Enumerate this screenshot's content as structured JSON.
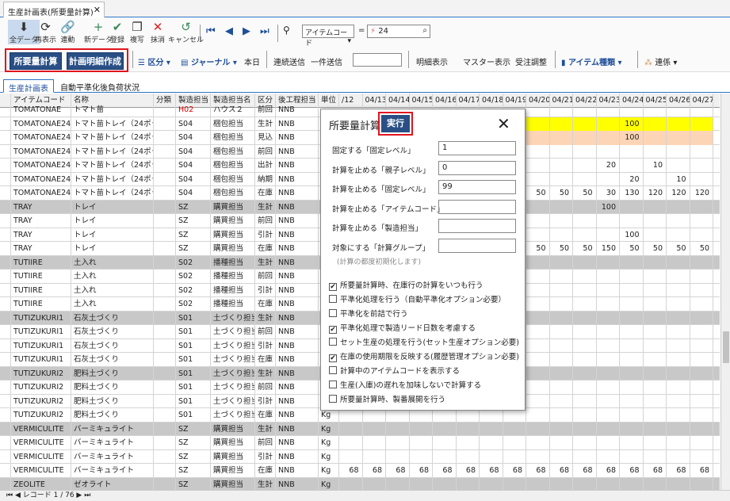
{
  "tab_title": "生産計画表(所要量計算)",
  "toolbar1": [
    {
      "label": "全データ",
      "icon": "⬇"
    },
    {
      "label": "再表示",
      "icon": "⟳"
    },
    {
      "label": "連動",
      "icon": "🔗"
    },
    {
      "label": "新データ",
      "icon": "+"
    },
    {
      "label": "登録",
      "icon": "✔"
    },
    {
      "label": "複写",
      "icon": "❐"
    },
    {
      "label": "抹消",
      "icon": "✕"
    },
    {
      "label": "キャンセル",
      "icon": "↺"
    }
  ],
  "filter": {
    "field": "アイテムコード",
    "op": "=",
    "value": "24"
  },
  "toolbar2": {
    "shoyo": "所要量計算",
    "keikaku": "計画明細作成",
    "kubun": "区分",
    "journal": "ジャーナル",
    "today": "本日",
    "renzoku": "連続送信",
    "ikken": "一件送信",
    "meisai": "明細表示",
    "master": "マスター表示",
    "juchu": "受注調整",
    "item_type": "アイテム種類",
    "renkei": "連係"
  },
  "subtabs": [
    "生産計画表",
    "自動平準化後負荷状況"
  ],
  "columns": [
    "アイテムコード",
    "名称",
    "分類",
    "製造担当",
    "製造担当名",
    "区分",
    "後工程担当",
    "単位"
  ],
  "dates": [
    "/12",
    "04/13",
    "04/14",
    "04/15",
    "04/16",
    "04/17",
    "04/18",
    "04/19",
    "04/20",
    "04/21",
    "04/22",
    "04/23",
    "04/24",
    "04/25",
    "04/26",
    "04/27"
  ],
  "rows": [
    {
      "code": "TOMATONAE",
      "name": "トマト苗",
      "cat": "",
      "tan": "H02",
      "tanname": "ハウス２",
      "kubun": "前回",
      "next": "NNB",
      "unit": "",
      "vals": [],
      "style": "top"
    },
    {
      "code": "TOMATONAE24",
      "name": "トマト苗トレイ（24ポット）",
      "cat": "",
      "tan": "S04",
      "tanname": "梱包担当",
      "kubun": "生計",
      "next": "NNB",
      "unit": "",
      "vals": [
        "",
        "",
        "",
        "",
        "",
        "",
        "",
        "",
        "",
        "",
        "",
        "",
        "100",
        "",
        "",
        ""
      ],
      "style": "yellow"
    },
    {
      "code": "TOMATONAE24",
      "name": "トマト苗トレイ（24ポット）",
      "cat": "",
      "tan": "S04",
      "tanname": "梱包担当",
      "kubun": "見込",
      "next": "NNB",
      "unit": "",
      "vals": [
        "",
        "",
        "",
        "",
        "",
        "",
        "",
        "",
        "",
        "",
        "",
        "",
        "100",
        "",
        "",
        ""
      ],
      "style": "peach"
    },
    {
      "code": "TOMATONAE24",
      "name": "トマト苗トレイ（24ポット）",
      "cat": "",
      "tan": "S04",
      "tanname": "梱包担当",
      "kubun": "前回",
      "next": "NNB",
      "unit": "",
      "vals": [],
      "style": ""
    },
    {
      "code": "TOMATONAE24",
      "name": "トマト苗トレイ（24ポット）",
      "cat": "",
      "tan": "S04",
      "tanname": "梱包担当",
      "kubun": "出計",
      "next": "NNB",
      "unit": "",
      "vals": [
        "",
        "",
        "",
        "",
        "",
        "",
        "",
        "",
        "",
        "",
        "",
        "20",
        "",
        "10",
        "",
        ""
      ],
      "style": ""
    },
    {
      "code": "TOMATONAE24",
      "name": "トマト苗トレイ（24ポット）",
      "cat": "",
      "tan": "S04",
      "tanname": "梱包担当",
      "kubun": "納期",
      "next": "NNB",
      "unit": "",
      "vals": [
        "",
        "",
        "",
        "",
        "",
        "",
        "",
        "",
        "",
        "",
        "",
        "",
        "20",
        "",
        "10",
        ""
      ],
      "style": ""
    },
    {
      "code": "TOMATONAE24",
      "name": "トマト苗トレイ（24ポット）",
      "cat": "",
      "tan": "S04",
      "tanname": "梱包担当",
      "kubun": "在庫",
      "next": "NNB",
      "unit": "",
      "vals": [
        "",
        "",
        "",
        "",
        "",
        "",
        "",
        "",
        "50",
        "50",
        "50",
        "30",
        "130",
        "120",
        "120",
        "120"
      ],
      "style": ""
    },
    {
      "code": "TRAY",
      "name": "トレイ",
      "cat": "",
      "tan": "SZ",
      "tanname": "購買担当",
      "kubun": "生計",
      "next": "NNB",
      "unit": "",
      "vals": [
        "",
        "",
        "",
        "",
        "",
        "",
        "",
        "",
        "",
        "",
        "",
        "100",
        "",
        "",
        "",
        ""
      ],
      "style": "gray"
    },
    {
      "code": "TRAY",
      "name": "トレイ",
      "cat": "",
      "tan": "SZ",
      "tanname": "購買担当",
      "kubun": "前回",
      "next": "NNB",
      "unit": "",
      "vals": [],
      "style": ""
    },
    {
      "code": "TRAY",
      "name": "トレイ",
      "cat": "",
      "tan": "SZ",
      "tanname": "購買担当",
      "kubun": "引計",
      "next": "NNB",
      "unit": "",
      "vals": [
        "",
        "",
        "",
        "",
        "",
        "",
        "",
        "",
        "",
        "",
        "",
        "",
        "100",
        "",
        "",
        ""
      ],
      "style": ""
    },
    {
      "code": "TRAY",
      "name": "トレイ",
      "cat": "",
      "tan": "SZ",
      "tanname": "購買担当",
      "kubun": "在庫",
      "next": "NNB",
      "unit": "",
      "vals": [
        "",
        "",
        "",
        "",
        "",
        "",
        "",
        "",
        "50",
        "50",
        "50",
        "150",
        "50",
        "50",
        "50",
        "50"
      ],
      "style": ""
    },
    {
      "code": "TUTIIRE",
      "name": "土入れ",
      "cat": "",
      "tan": "S02",
      "tanname": "播種担当",
      "kubun": "生計",
      "next": "NNB",
      "unit": "",
      "vals": [],
      "style": "gray"
    },
    {
      "code": "TUTIIRE",
      "name": "土入れ",
      "cat": "",
      "tan": "S02",
      "tanname": "播種担当",
      "kubun": "前回",
      "next": "NNB",
      "unit": "",
      "vals": [],
      "style": ""
    },
    {
      "code": "TUTIIRE",
      "name": "土入れ",
      "cat": "",
      "tan": "S02",
      "tanname": "播種担当",
      "kubun": "引計",
      "next": "NNB",
      "unit": "",
      "vals": [],
      "style": ""
    },
    {
      "code": "TUTIIRE",
      "name": "土入れ",
      "cat": "",
      "tan": "S02",
      "tanname": "播種担当",
      "kubun": "在庫",
      "next": "NNB",
      "unit": "",
      "vals": [],
      "style": ""
    },
    {
      "code": "TUTIZUKURI1",
      "name": "石灰土づくり",
      "cat": "",
      "tan": "S01",
      "tanname": "土づくり担当",
      "kubun": "生計",
      "next": "NNB",
      "unit": "",
      "vals": [],
      "style": "gray"
    },
    {
      "code": "TUTIZUKURI1",
      "name": "石灰土づくり",
      "cat": "",
      "tan": "S01",
      "tanname": "土づくり担当",
      "kubun": "前回",
      "next": "NNB",
      "unit": "",
      "vals": [],
      "style": ""
    },
    {
      "code": "TUTIZUKURI1",
      "name": "石灰土づくり",
      "cat": "",
      "tan": "S01",
      "tanname": "土づくり担当",
      "kubun": "引計",
      "next": "NNB",
      "unit": "",
      "vals": [],
      "style": ""
    },
    {
      "code": "TUTIZUKURI1",
      "name": "石灰土づくり",
      "cat": "",
      "tan": "S01",
      "tanname": "土づくり担当",
      "kubun": "在庫",
      "next": "NNB",
      "unit": "",
      "vals": [],
      "style": ""
    },
    {
      "code": "TUTIZUKURI2",
      "name": "肥料土づくり",
      "cat": "",
      "tan": "S01",
      "tanname": "土づくり担当",
      "kubun": "生計",
      "next": "NNB",
      "unit": "",
      "vals": [],
      "style": "gray"
    },
    {
      "code": "TUTIZUKURI2",
      "name": "肥料土づくり",
      "cat": "",
      "tan": "S01",
      "tanname": "土づくり担当",
      "kubun": "前回",
      "next": "NNB",
      "unit": "",
      "vals": [],
      "style": ""
    },
    {
      "code": "TUTIZUKURI2",
      "name": "肥料土づくり",
      "cat": "",
      "tan": "S01",
      "tanname": "土づくり担当",
      "kubun": "引計",
      "next": "NNB",
      "unit": "",
      "vals": [],
      "style": ""
    },
    {
      "code": "TUTIZUKURI2",
      "name": "肥料土づくり",
      "cat": "",
      "tan": "S01",
      "tanname": "土づくり担当",
      "kubun": "在庫",
      "next": "NNB",
      "unit": "Kg",
      "vals": [],
      "style": ""
    },
    {
      "code": "VERMICULITE",
      "name": "バーミキュライト",
      "cat": "",
      "tan": "SZ",
      "tanname": "購買担当",
      "kubun": "生計",
      "next": "NNB",
      "unit": "Kg",
      "vals": [],
      "style": "gray"
    },
    {
      "code": "VERMICULITE",
      "name": "バーミキュライト",
      "cat": "",
      "tan": "SZ",
      "tanname": "購買担当",
      "kubun": "前回",
      "next": "NNB",
      "unit": "Kg",
      "vals": [],
      "style": ""
    },
    {
      "code": "VERMICULITE",
      "name": "バーミキュライト",
      "cat": "",
      "tan": "SZ",
      "tanname": "購買担当",
      "kubun": "引計",
      "next": "NNB",
      "unit": "Kg",
      "vals": [],
      "style": ""
    },
    {
      "code": "VERMICULITE",
      "name": "バーミキュライト",
      "cat": "",
      "tan": "SZ",
      "tanname": "購買担当",
      "kubun": "在庫",
      "next": "NNB",
      "unit": "Kg",
      "vals": [
        "68",
        "68",
        "68",
        "68",
        "68",
        "68",
        "68",
        "68",
        "68",
        "68",
        "68",
        "68",
        "68",
        "68",
        "68",
        "68"
      ],
      "style": ""
    },
    {
      "code": "ZEOLITE",
      "name": "ゼオライト",
      "cat": "",
      "tan": "SZ",
      "tanname": "購買担当",
      "kubun": "生計",
      "next": "NNB",
      "unit": "Kg",
      "vals": [],
      "style": "gray"
    }
  ],
  "status": "レコード 1 / 76",
  "dialog": {
    "title": "所要量計算",
    "run": "実行",
    "fields": [
      {
        "label": "固定する「固定レベル」",
        "value": "1"
      },
      {
        "label": "計算を止める「親子レベル」",
        "value": "0"
      },
      {
        "label": "計算を止める「固定レベル」",
        "value": "99"
      },
      {
        "label": "計算を止める「アイテムコード」",
        "value": ""
      },
      {
        "label": "計算を止める「製造担当」",
        "value": ""
      },
      {
        "label": "対象にする「計算グループ」",
        "value": ""
      }
    ],
    "note": "(計算の都度初期化します)",
    "checks": [
      {
        "label": "所要量計算時、在庫行の計算をいつも行う",
        "checked": true
      },
      {
        "label": "平準化処理を行う（自動平準化オプション必要）",
        "checked": false
      },
      {
        "label": "平準化を前詰で行う",
        "checked": false
      },
      {
        "label": "平準化処理で製造リード日数を考慮する",
        "checked": true
      },
      {
        "label": "セット生産の処理を行う(セット生産オプション必要)",
        "checked": false
      },
      {
        "label": "在庫の使用期限を反映する(履歴管理オプション必要)",
        "checked": true
      },
      {
        "label": "計算中のアイテムコードを表示する",
        "checked": false
      },
      {
        "label": "生産(入庫)の遅れを加味しないで計算する",
        "checked": false
      },
      {
        "label": "所要量計算時、製番展開を行う",
        "checked": false
      }
    ]
  }
}
